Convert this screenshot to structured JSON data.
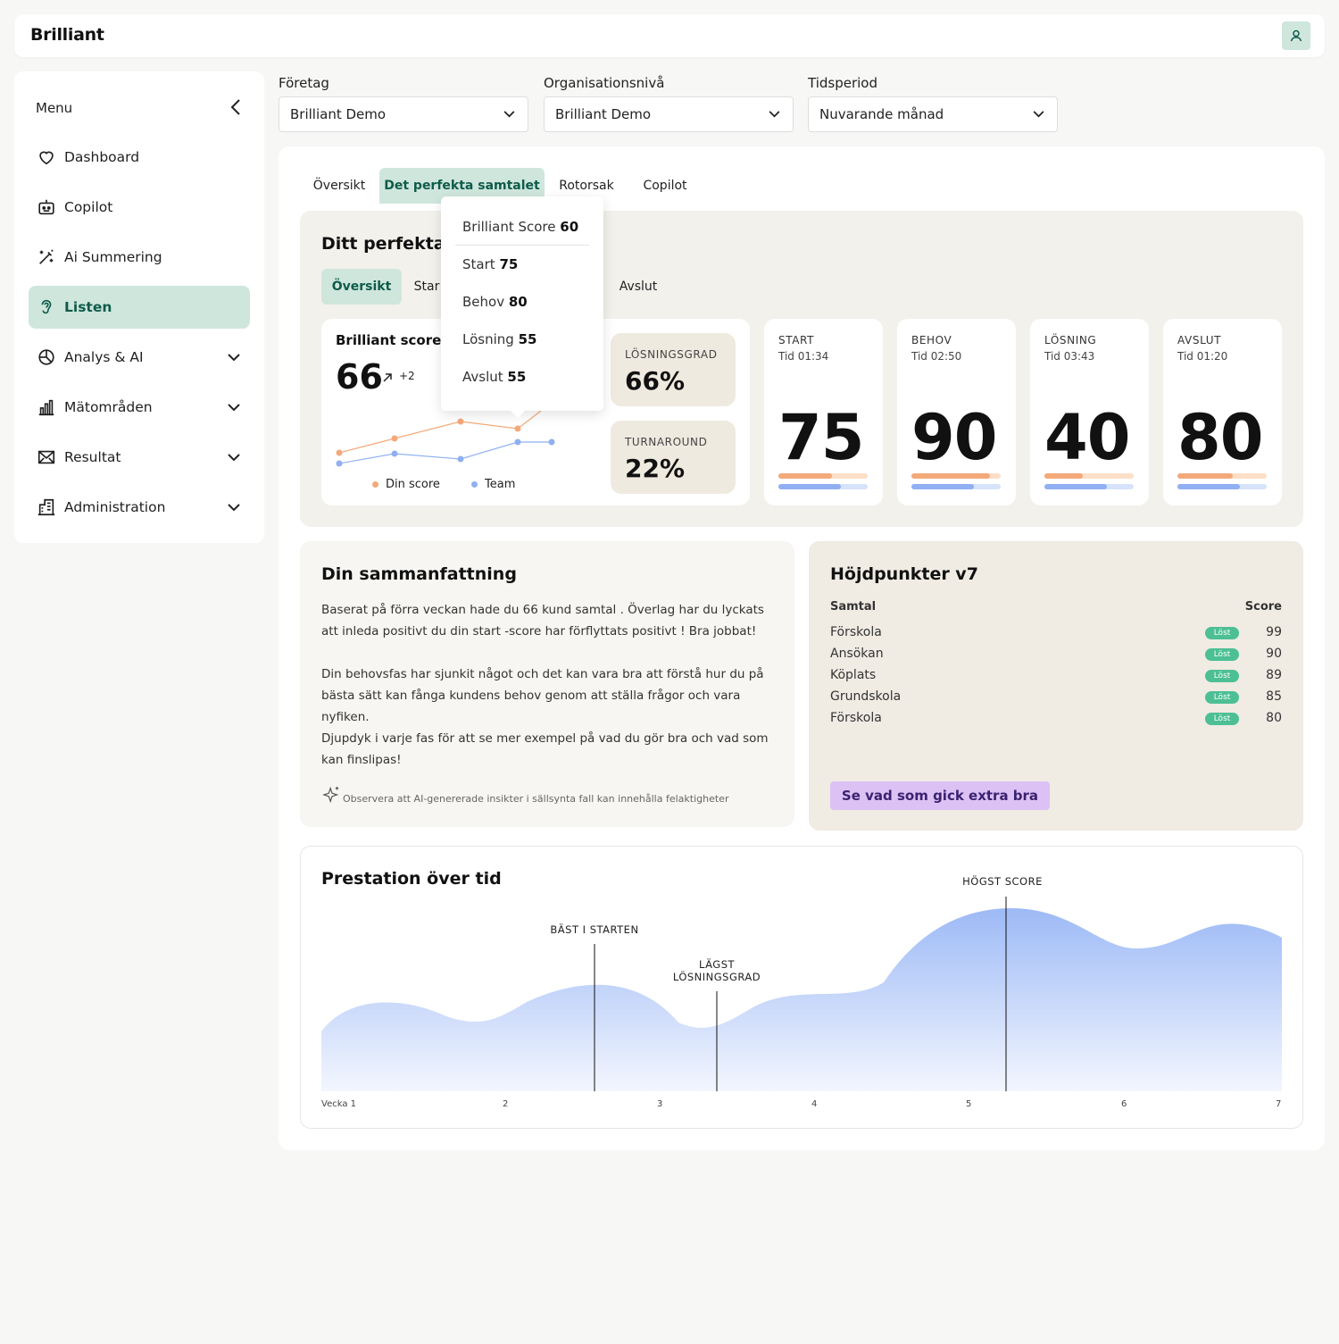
{
  "header": {
    "logo": "Brilliant"
  },
  "sidebar": {
    "title": "Menu",
    "items": [
      {
        "label": "Dashboard",
        "icon": "heart-icon"
      },
      {
        "label": "Copilot",
        "icon": "robot-icon"
      },
      {
        "label": "Ai Summering",
        "icon": "magic-wand-icon"
      },
      {
        "label": "Listen",
        "icon": "ear-icon"
      },
      {
        "label": "Analys & AI",
        "icon": "pie-chart-icon"
      },
      {
        "label": "Mätområden",
        "icon": "bar-chart-icon"
      },
      {
        "label": "Resultat",
        "icon": "mail-x-icon"
      },
      {
        "label": "Administration",
        "icon": "building-icon"
      }
    ]
  },
  "filters": {
    "company": {
      "label": "Företag",
      "value": "Brilliant Demo"
    },
    "org": {
      "label": "Organisationsnivå",
      "value": "Brilliant Demo"
    },
    "period": {
      "label": "Tidsperiod",
      "value": "Nuvarande månad"
    }
  },
  "tabs": [
    "Översikt",
    "Det perfekta samtalet",
    "Rotorsak",
    "Copilot"
  ],
  "perfect": {
    "title": "Ditt perfekta",
    "subtabs": [
      "Översikt",
      "Star",
      "Avslut"
    ],
    "score_card": {
      "title": "Brilliant score v",
      "value": "66",
      "delta": "+2",
      "legend_you": "Din score",
      "legend_team": "Team"
    },
    "stats": [
      {
        "label": "LÖSNINGSGRAD",
        "value": "66%"
      },
      {
        "label": "TURNAROUND",
        "value": "22%"
      }
    ],
    "phases": [
      {
        "label": "START",
        "time": "Tid 01:34",
        "value": "75",
        "you": 0.6,
        "team": 0.7
      },
      {
        "label": "BEHOV",
        "time": "Tid 02:50",
        "value": "90",
        "you": 0.88,
        "team": 0.7
      },
      {
        "label": "LÖSNING",
        "time": "Tid 03:43",
        "value": "40",
        "you": 0.43,
        "team": 0.7
      },
      {
        "label": "AVSLUT",
        "time": "Tid 01:20",
        "value": "80",
        "you": 0.62,
        "team": 0.7
      }
    ],
    "popover": [
      {
        "label": "Brilliant Score",
        "value": "60"
      },
      {
        "label": "Start",
        "value": "75"
      },
      {
        "label": "Behov",
        "value": "80"
      },
      {
        "label": "Lösning",
        "value": "55"
      },
      {
        "label": "Avslut",
        "value": "55"
      }
    ]
  },
  "summary": {
    "title": "Din sammanfattning",
    "p1a": "Baserat på förra veckan hade du 66 kund samtal . Överlag har du lyckats",
    "p1b": "att inleda positivt du din start -score har förflyttats positivt ! Bra jobbat!",
    "p2a": "Din behovsfas har sjunkit något och det kan vara bra att förstå hur du på",
    "p2b": "bästa sätt kan fånga kundens behov genom att ställa frågor och vara",
    "p2c": "nyfiken.",
    "p3a": "Djupdyk i varje fas för att se mer exempel på vad du gör bra och vad som",
    "p3b": "kan finslipas!",
    "disclaimer": "Observera att AI-genererade insikter i sällsynta fall kan innehålla felaktigheter"
  },
  "highlights": {
    "title": "Höjdpunkter v7",
    "col_call": "Samtal",
    "col_score": "Score",
    "rows": [
      {
        "name": "Förskola",
        "badge": "Löst",
        "score": "99"
      },
      {
        "name": "Ansökan",
        "badge": "Löst",
        "score": "90"
      },
      {
        "name": "Köplats",
        "badge": "Löst",
        "score": "89"
      },
      {
        "name": "Grundskola",
        "badge": "Löst",
        "score": "85"
      },
      {
        "name": "Förskola",
        "badge": "Löst",
        "score": "80"
      }
    ],
    "cta": "Se vad som gick extra bra"
  },
  "performance": {
    "title": "Prestation över tid",
    "annotations": {
      "best_start": "BÄST I STARTEN",
      "lowest_a": "LÄGST",
      "lowest_b": "LÖSNINGSGRAD",
      "highest": "HÖGST SCORE"
    },
    "xticks": [
      "Vecka 1",
      "2",
      "3",
      "4",
      "5",
      "6",
      "7"
    ]
  },
  "chart_data": [
    {
      "type": "line",
      "title": "Brilliant score v",
      "x": [
        1,
        2,
        3,
        4,
        5
      ],
      "series": [
        {
          "name": "Din score",
          "values": [
            60,
            63,
            66,
            65,
            70
          ],
          "color": "#f4a97a"
        },
        {
          "name": "Team",
          "values": [
            57,
            59,
            58,
            62,
            62
          ],
          "color": "#8fb0f2"
        }
      ]
    },
    {
      "type": "area",
      "title": "Prestation över tid",
      "xlabel": "",
      "x": [
        "Vecka 1",
        "2",
        "3",
        "4",
        "5",
        "6",
        "7"
      ],
      "series": [
        {
          "values": [
            50,
            55,
            68,
            50,
            72,
            100,
            82,
            88
          ]
        }
      ],
      "ylim": [
        0,
        110
      ],
      "color": "#9dbaf6"
    }
  ],
  "colors": {
    "accent_green": "#cfe6dc",
    "accent_green_text": "#0f5b4a",
    "orange": "#f4a97a",
    "blue": "#8fb0f2",
    "beige": "#f3f1ec",
    "cta": "#dcc1f5"
  }
}
